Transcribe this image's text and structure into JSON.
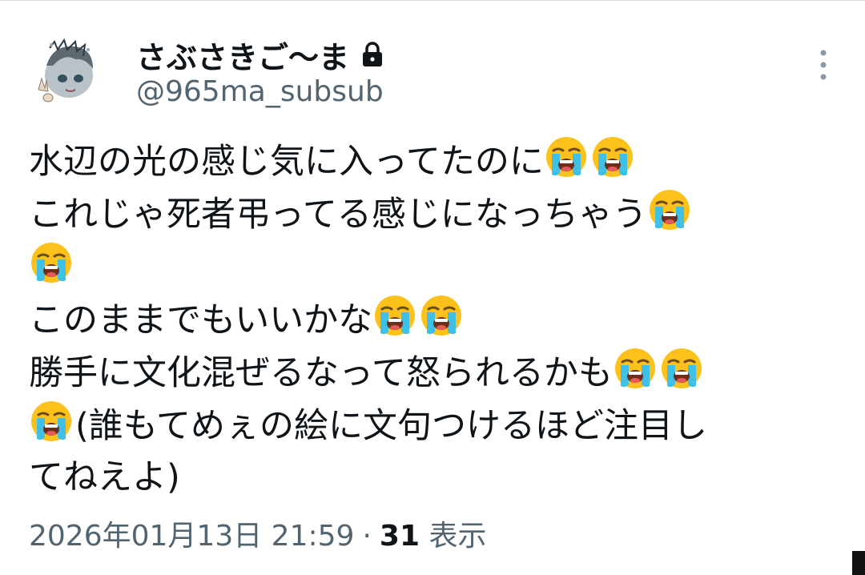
{
  "author": {
    "display_name": "さぶさきご〜ま",
    "handle": "@965ma_subsub",
    "protected_icon": "lock-icon",
    "avatar_icon": "avatar-illustration"
  },
  "menu": {
    "icon": "more-vertical-icon"
  },
  "tweet": {
    "lines": [
      {
        "text": "水辺の光の感じ気に入ってたのに",
        "emoji_after": 2,
        "emoji_before": 0
      },
      {
        "text": "これじゃ死者弔ってる感じになっちゃう",
        "emoji_after": 1,
        "emoji_before": 0
      },
      {
        "text": "",
        "emoji_after": 1,
        "emoji_before": 0
      },
      {
        "text": "このままでもいいかな",
        "emoji_after": 2,
        "emoji_before": 0
      },
      {
        "text": "勝手に文化混ぜるなって怒られるかも",
        "emoji_after": 2,
        "emoji_before": 0
      },
      {
        "text": "(誰もてめぇの絵に文句つけるほど注目し",
        "emoji_after": 0,
        "emoji_before": 1
      },
      {
        "text": "てねえよ)",
        "emoji_after": 0,
        "emoji_before": 0
      }
    ],
    "emoji_icon": "loudly-crying-face-icon"
  },
  "meta": {
    "timestamp": "2026年01月13日 21:59",
    "separator": "·",
    "views_count": "31",
    "views_label": "表示"
  },
  "colors": {
    "text": "#0f1419",
    "secondary": "#536471",
    "emoji_face": "#fcc21b",
    "emoji_tears": "#40c0e7"
  }
}
